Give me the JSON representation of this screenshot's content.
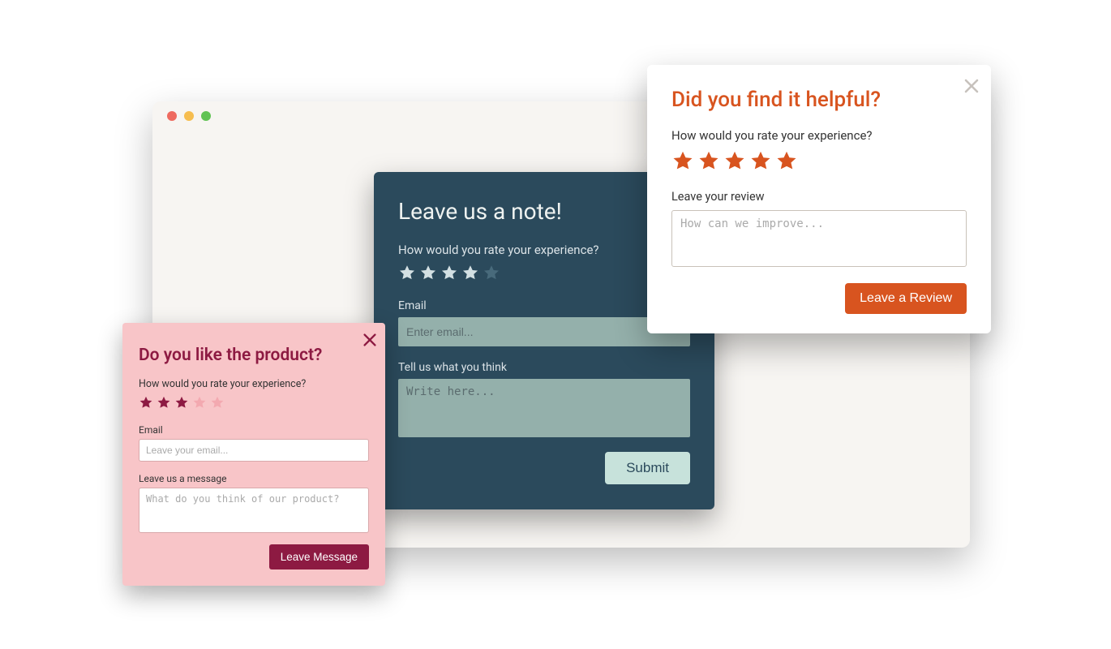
{
  "colors": {
    "orange": "#d8541f",
    "maroon": "#8d1a42",
    "blueDark": "#2b4a5c",
    "blueInput": "#94b0ab",
    "blueButton": "#c7e2db",
    "pink": "#f8c5c8"
  },
  "browser": {
    "traffic_lights": [
      "red",
      "yellow",
      "green"
    ]
  },
  "card_blue": {
    "title": "Leave us a note!",
    "rating_question": "How would you rate your experience?",
    "rating_value": 4,
    "rating_max": 5,
    "email_label": "Email",
    "email_placeholder": "Enter email...",
    "message_label": "Tell us what you think",
    "message_placeholder": "Write here...",
    "submit_label": "Submit"
  },
  "card_pink": {
    "title": "Do you like the product?",
    "rating_question": "How would you rate your experience?",
    "rating_value": 3,
    "rating_max": 5,
    "email_label": "Email",
    "email_placeholder": "Leave your email...",
    "message_label": "Leave us a message",
    "message_placeholder": "What do you think of our product?",
    "submit_label": "Leave Message"
  },
  "card_white": {
    "title": "Did you find it helpful?",
    "rating_question": "How would you rate your experience?",
    "rating_value": 5,
    "rating_max": 5,
    "review_label": "Leave your review",
    "review_placeholder": "How can we improve...",
    "submit_label": "Leave a Review"
  }
}
